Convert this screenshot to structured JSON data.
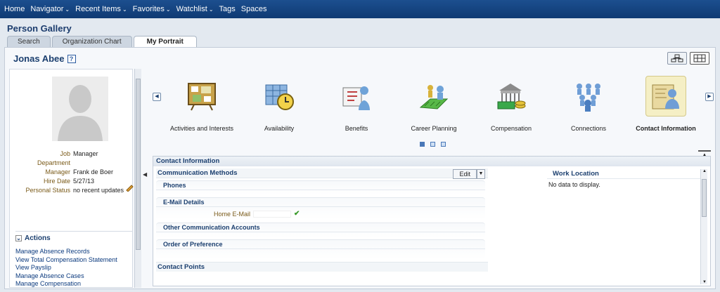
{
  "topnav": [
    "Home",
    "Navigator",
    "Recent Items",
    "Favorites",
    "Watchlist",
    "Tags",
    "Spaces"
  ],
  "topnav_caret": [
    false,
    true,
    true,
    true,
    true,
    false,
    false
  ],
  "gallery_title": "Person Gallery",
  "tabs": [
    "Search",
    "Organization Chart",
    "My Portrait"
  ],
  "person": {
    "name": "Jonas Abee",
    "help": "?",
    "fields": [
      {
        "label": "Job",
        "value": "Manager"
      },
      {
        "label": "Department",
        "value": ""
      },
      {
        "label": "Manager",
        "value": "Frank de Boer"
      },
      {
        "label": "Hire Date",
        "value": "5/27/13"
      },
      {
        "label": "Personal Status",
        "value": "no recent updates"
      }
    ]
  },
  "actions": {
    "title": "Actions",
    "items": [
      "Manage Absence Records",
      "View Total Compensation Statement",
      "View Payslip",
      "Manage Absence Cases",
      "Manage Compensation"
    ]
  },
  "carousel": {
    "items": [
      "Activities and Interests",
      "Availability",
      "Benefits",
      "Career Planning",
      "Compensation",
      "Connections",
      "Contact Information"
    ],
    "selected": "Contact Information"
  },
  "detail": {
    "title": "Contact Information",
    "comm_methods": "Communication Methods",
    "edit": "Edit",
    "phones": "Phones",
    "email_details": "E-Mail Details",
    "home_email_label": "Home E-Mail",
    "other_comm": "Other Communication Accounts",
    "order_pref": "Order of Preference",
    "contact_points": "Contact Points",
    "work_location": "Work Location",
    "no_data": "No data to display."
  },
  "colors": {
    "topbar": "#123f7a",
    "accent": "#1b3f6f",
    "label": "#7a5a18"
  }
}
